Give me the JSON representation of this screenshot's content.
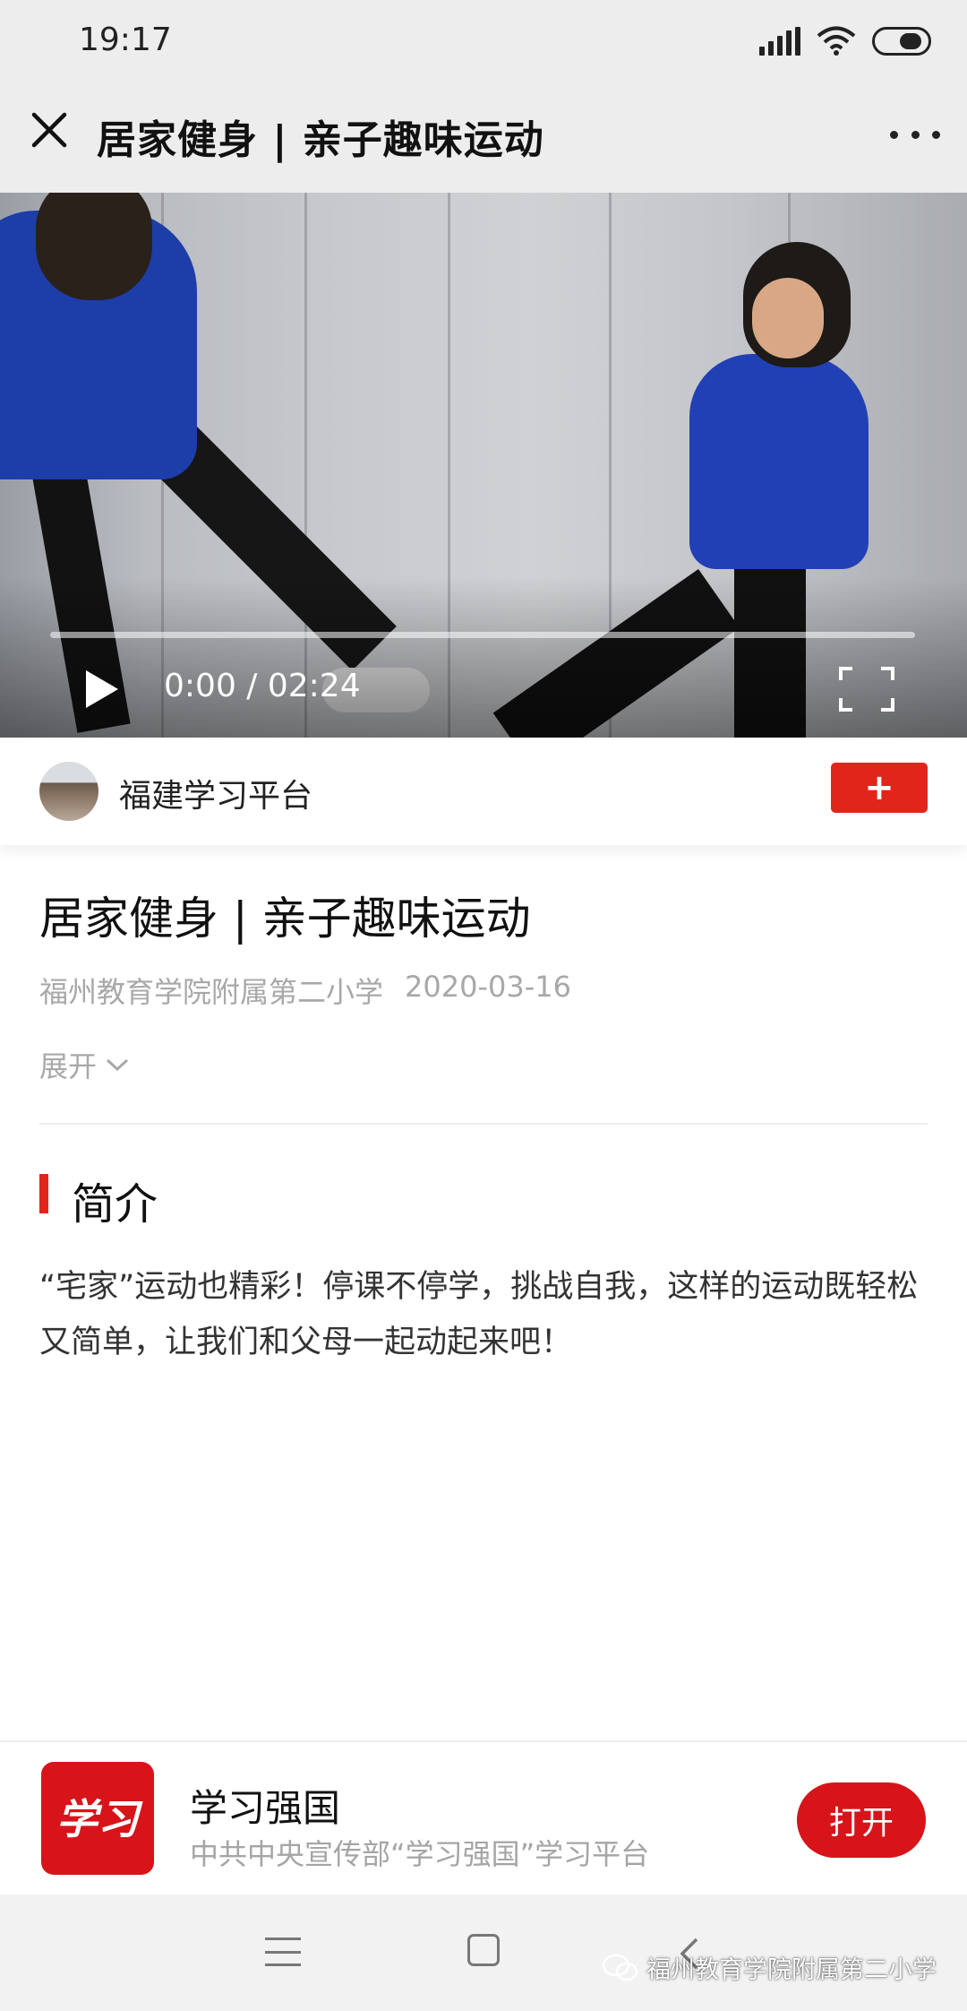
{
  "status_bar": {
    "time": "19:17"
  },
  "header": {
    "title": "居家健身 | 亲子趣味运动"
  },
  "video": {
    "time_display": "0:00 / 02:24",
    "progress": 0
  },
  "channel": {
    "name": "福建学习平台",
    "follow_label": "+"
  },
  "article": {
    "title": "居家健身 | 亲子趣味运动",
    "source": "福州教育学院附属第二小学",
    "date": "2020-03-16",
    "expand_label": "展开",
    "section_title": "简介",
    "intro": "“宅家”运动也精彩！停课不停学，挑战自我，这样的运动既轻松又简单，让我们和父母一起动起来吧！"
  },
  "app_banner": {
    "logo_text": "学习",
    "name": "学习强国",
    "description": "中共中央宣传部“学习强国”学习平台",
    "open_label": "打开"
  },
  "watermark": {
    "text": "福州教育学院附属第二小学"
  },
  "colors": {
    "accent_red": "#e1251b",
    "app_red": "#d7141a",
    "header_bg": "#ededed"
  },
  "icons": [
    "close-icon",
    "more-icon",
    "play-icon",
    "fullscreen-icon",
    "chevron-down-icon",
    "wechat-icon",
    "signal-icon",
    "wifi-icon",
    "battery-icon"
  ]
}
